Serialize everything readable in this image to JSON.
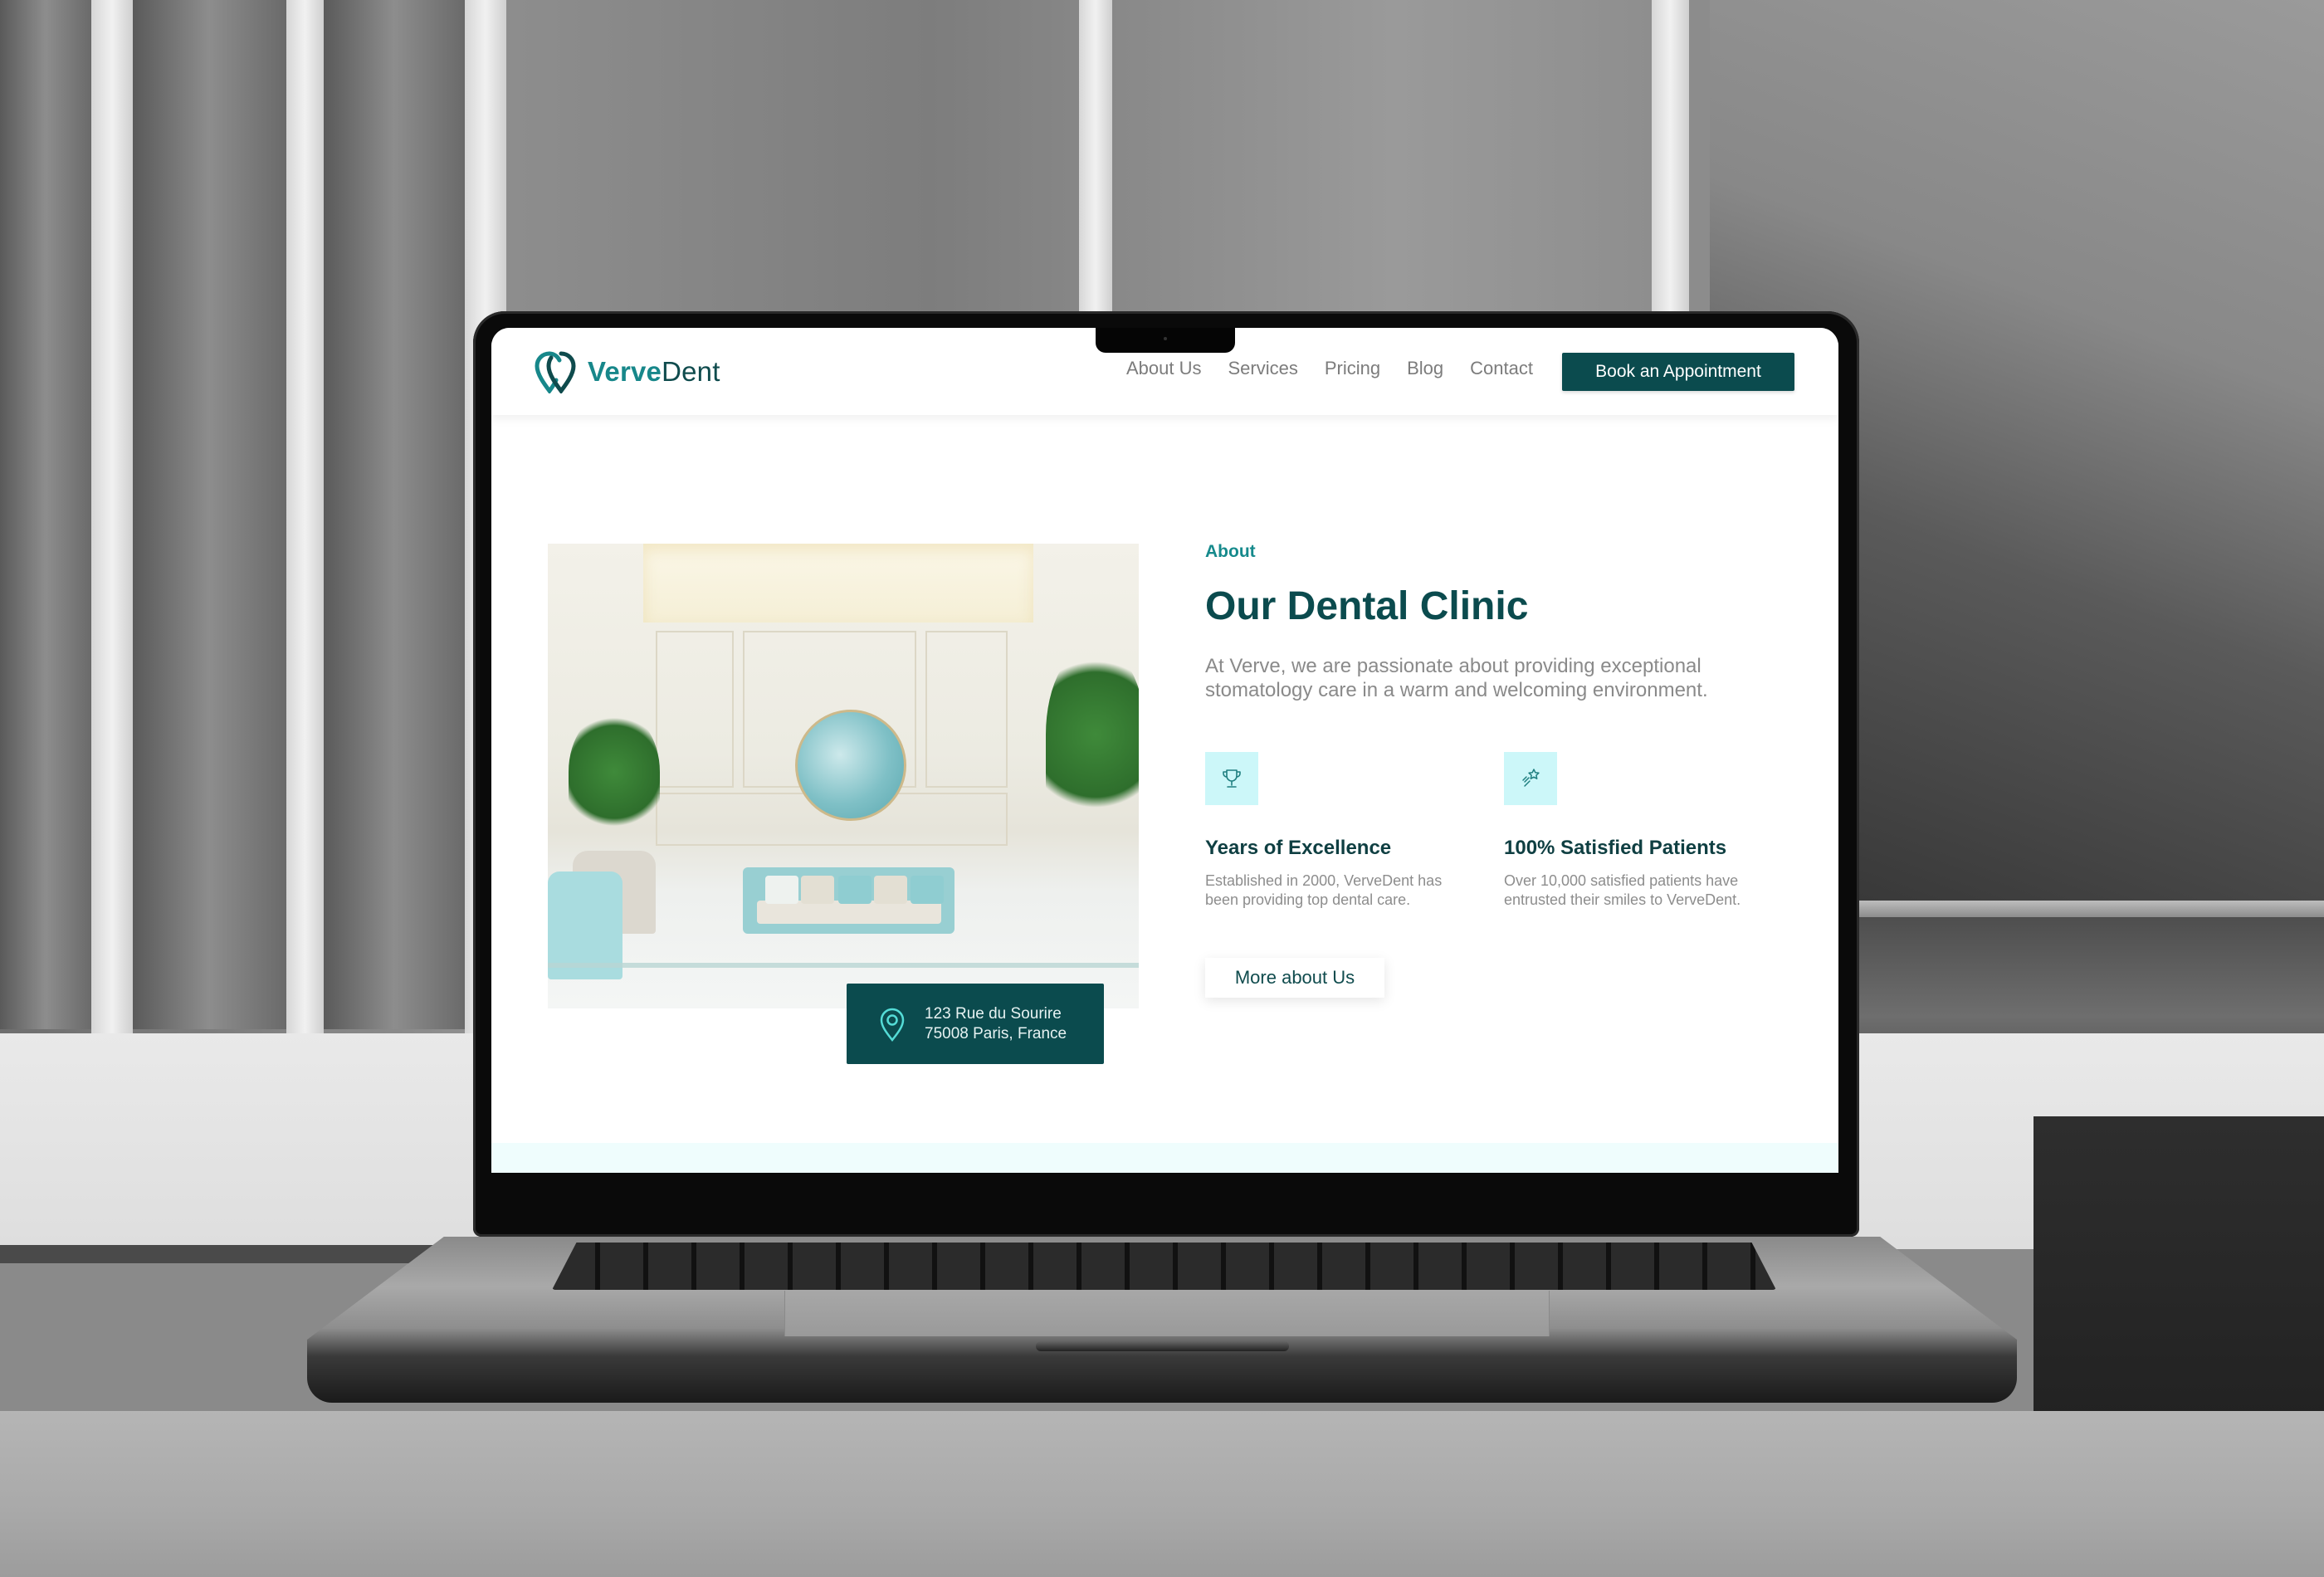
{
  "site": {
    "brand": {
      "part1": "Verve",
      "part2": "Dent"
    },
    "nav": [
      "About Us",
      "Services",
      "Pricing",
      "Blog",
      "Contact"
    ],
    "cta_label": "Book an Appointment"
  },
  "about": {
    "eyebrow": "About",
    "title": "Our Dental Clinic",
    "lede": "At Verve, we are passionate about providing exceptional stomatology care in a warm and welcoming environment.",
    "features": [
      {
        "icon": "trophy-icon",
        "title": "Years of Excellence",
        "desc": "Established in 2000, VerveDent has been providing top dental care."
      },
      {
        "icon": "shooting-star-icon",
        "title": "100% Satisfied Patients",
        "desc": "Over 10,000 satisfied patients have entrusted their smiles to VerveDent."
      }
    ],
    "more_label": "More about Us"
  },
  "address": {
    "icon": "map-pin-icon",
    "line1": "123 Rue du Sourire",
    "line2": "75008 Paris, France"
  },
  "colors": {
    "brand_dark": "#0b4b4e",
    "brand_teal": "#17878a",
    "icon_bg": "#ccf7f9"
  }
}
